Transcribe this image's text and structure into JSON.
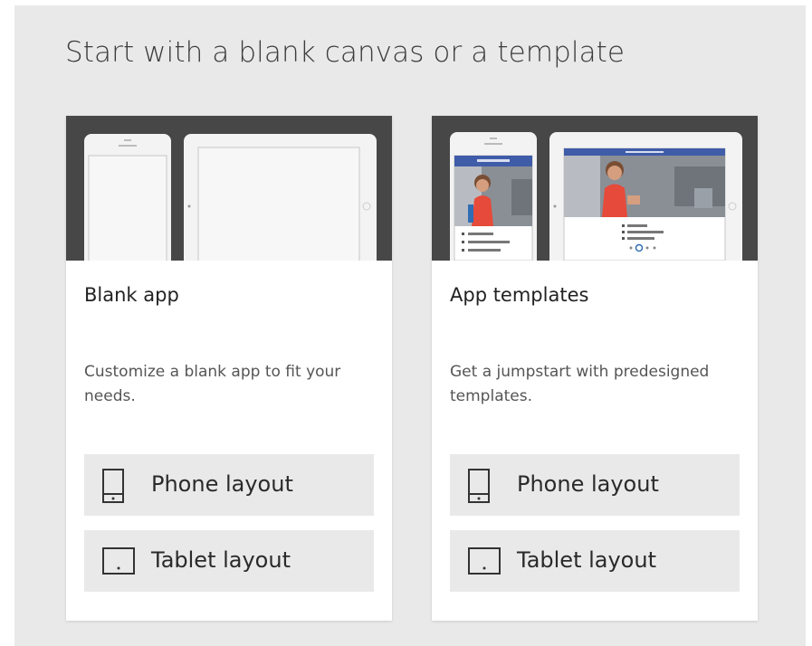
{
  "heading": "Start with a blank canvas or a template",
  "cards": [
    {
      "title": "Blank app",
      "description": "Customize a blank app to fit your needs.",
      "buttons": [
        {
          "label": "Phone layout",
          "icon": "phone-icon"
        },
        {
          "label": "Tablet layout",
          "icon": "tablet-icon"
        }
      ]
    },
    {
      "title": "App templates",
      "description": "Get a jumpstart with predesigned templates.",
      "buttons": [
        {
          "label": "Phone layout",
          "icon": "phone-icon"
        },
        {
          "label": "Tablet layout",
          "icon": "tablet-icon"
        }
      ]
    }
  ],
  "colors": {
    "panel_bg": "#e9e9e9",
    "preview_bg": "#474747",
    "template_header": "#3f5ca8",
    "person_dress": "#e64a3a"
  }
}
